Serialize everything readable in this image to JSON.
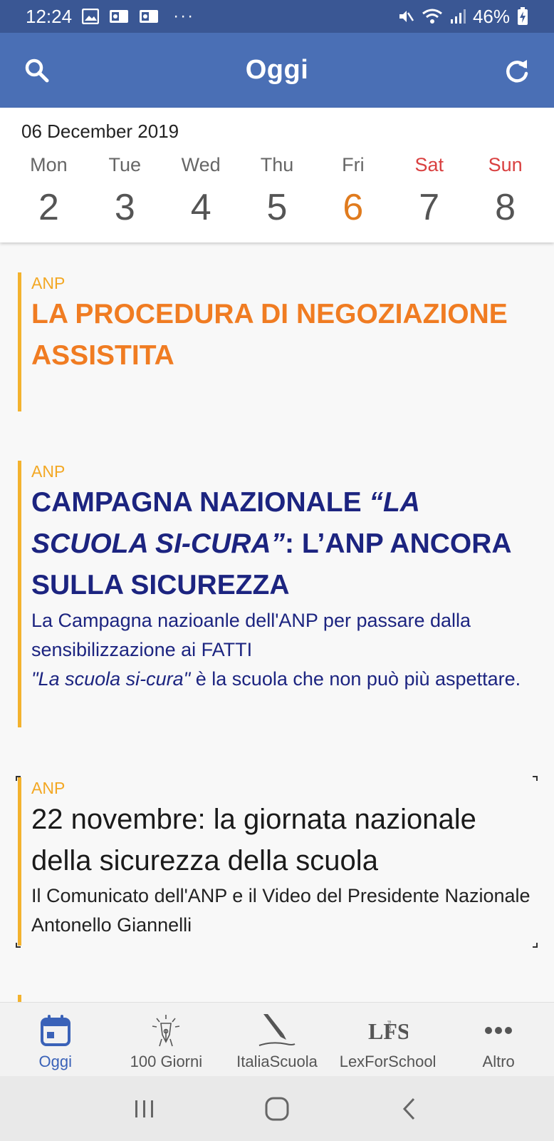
{
  "status": {
    "time": "12:24",
    "dots": "···",
    "battery": "46%"
  },
  "app_bar": {
    "title": "Oggi"
  },
  "week": {
    "date": "06 December 2019",
    "days": [
      {
        "name": "Mon",
        "num": "2"
      },
      {
        "name": "Tue",
        "num": "3"
      },
      {
        "name": "Wed",
        "num": "4"
      },
      {
        "name": "Thu",
        "num": "5"
      },
      {
        "name": "Fri",
        "num": "6"
      },
      {
        "name": "Sat",
        "num": "7"
      },
      {
        "name": "Sun",
        "num": "8"
      }
    ]
  },
  "feed": [
    {
      "source": "ANP",
      "title": "LA PROCEDURA DI NEGOZIAZIONE ASSISTITA"
    },
    {
      "source": "ANP",
      "title_italic": "“LA SCUOLA SI-CURA”",
      "title_prefix": "CAMPAGNA NAZIONALE ",
      "title_suffix": ": L’ANP ANCORA SULLA SICUREZZA",
      "sub_line1": "La Campagna nazioanle dell'ANP per passare dalla sensibilizzazione ai FATTI",
      "sub_italic": "\"La scuola si-cura\"",
      "sub_line2": " è la scuola che non può più aspettare."
    },
    {
      "source": "ANP",
      "title": "22 novembre: la giornata nazionale della sicurezza della scuola",
      "sub": "Il Comunicato dell'ANP e il Video del Presidente Nazionale Antonello Giannelli"
    }
  ],
  "bottom_nav": [
    {
      "label": "Oggi",
      "icon": "calendar-icon",
      "active": true
    },
    {
      "label": "100 Giorni",
      "icon": "pen-nib-icon"
    },
    {
      "label": "ItaliaScuola",
      "icon": "quill-icon"
    },
    {
      "label": "LexForSchool",
      "icon": "lfs-logo-icon",
      "logo_text": "LFS",
      "logo_for": "FOR"
    },
    {
      "label": "Altro",
      "icon": "more-dots-icon"
    }
  ],
  "colors": {
    "status_bar": "#3a5794",
    "app_bar": "#4a6fb5",
    "accent_orange": "#f07c22",
    "navy": "#1c2480",
    "source_yellow": "#f3a824",
    "weekend_red": "#d94040",
    "today_orange": "#e07b1e"
  }
}
